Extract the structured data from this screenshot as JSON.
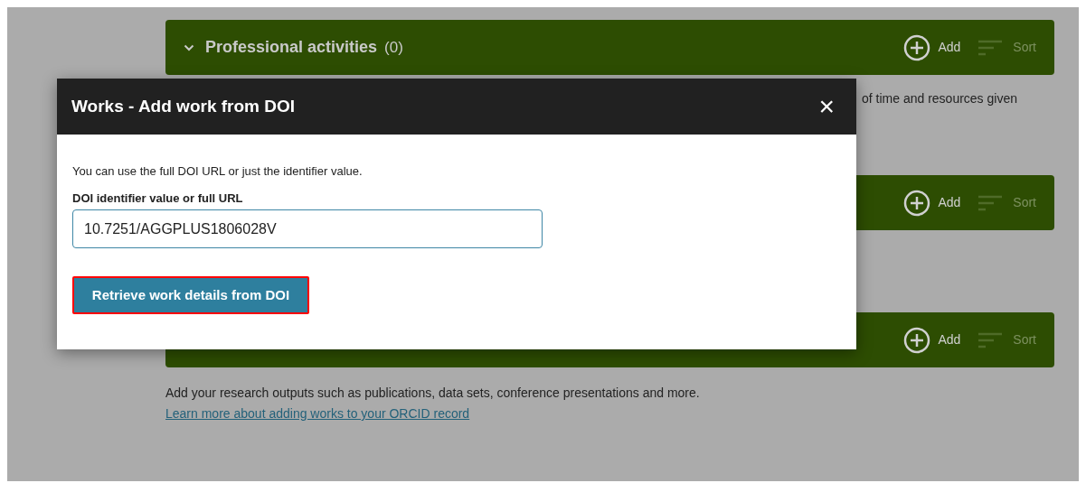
{
  "sections": [
    {
      "title": "Professional activities",
      "count": "(0)",
      "expanded": true,
      "add": "Add",
      "sort": "Sort",
      "description": "of time and resources given"
    },
    {
      "add": "Add",
      "sort": "Sort"
    },
    {
      "add": "Add",
      "sort": "Sort",
      "description": "Add your research outputs such as publications, data sets, conference presentations and more.",
      "link": "Learn more about adding works to your ORCID record"
    }
  ],
  "dialog": {
    "title": "Works - Add work from DOI",
    "close": "×",
    "hint": "You can use the full DOI URL or just the identifier value.",
    "field_label": "DOI identifier value or full URL",
    "field_value": "10.7251/AGGPLUS1806028V",
    "button": "Retrieve work details from DOI"
  }
}
